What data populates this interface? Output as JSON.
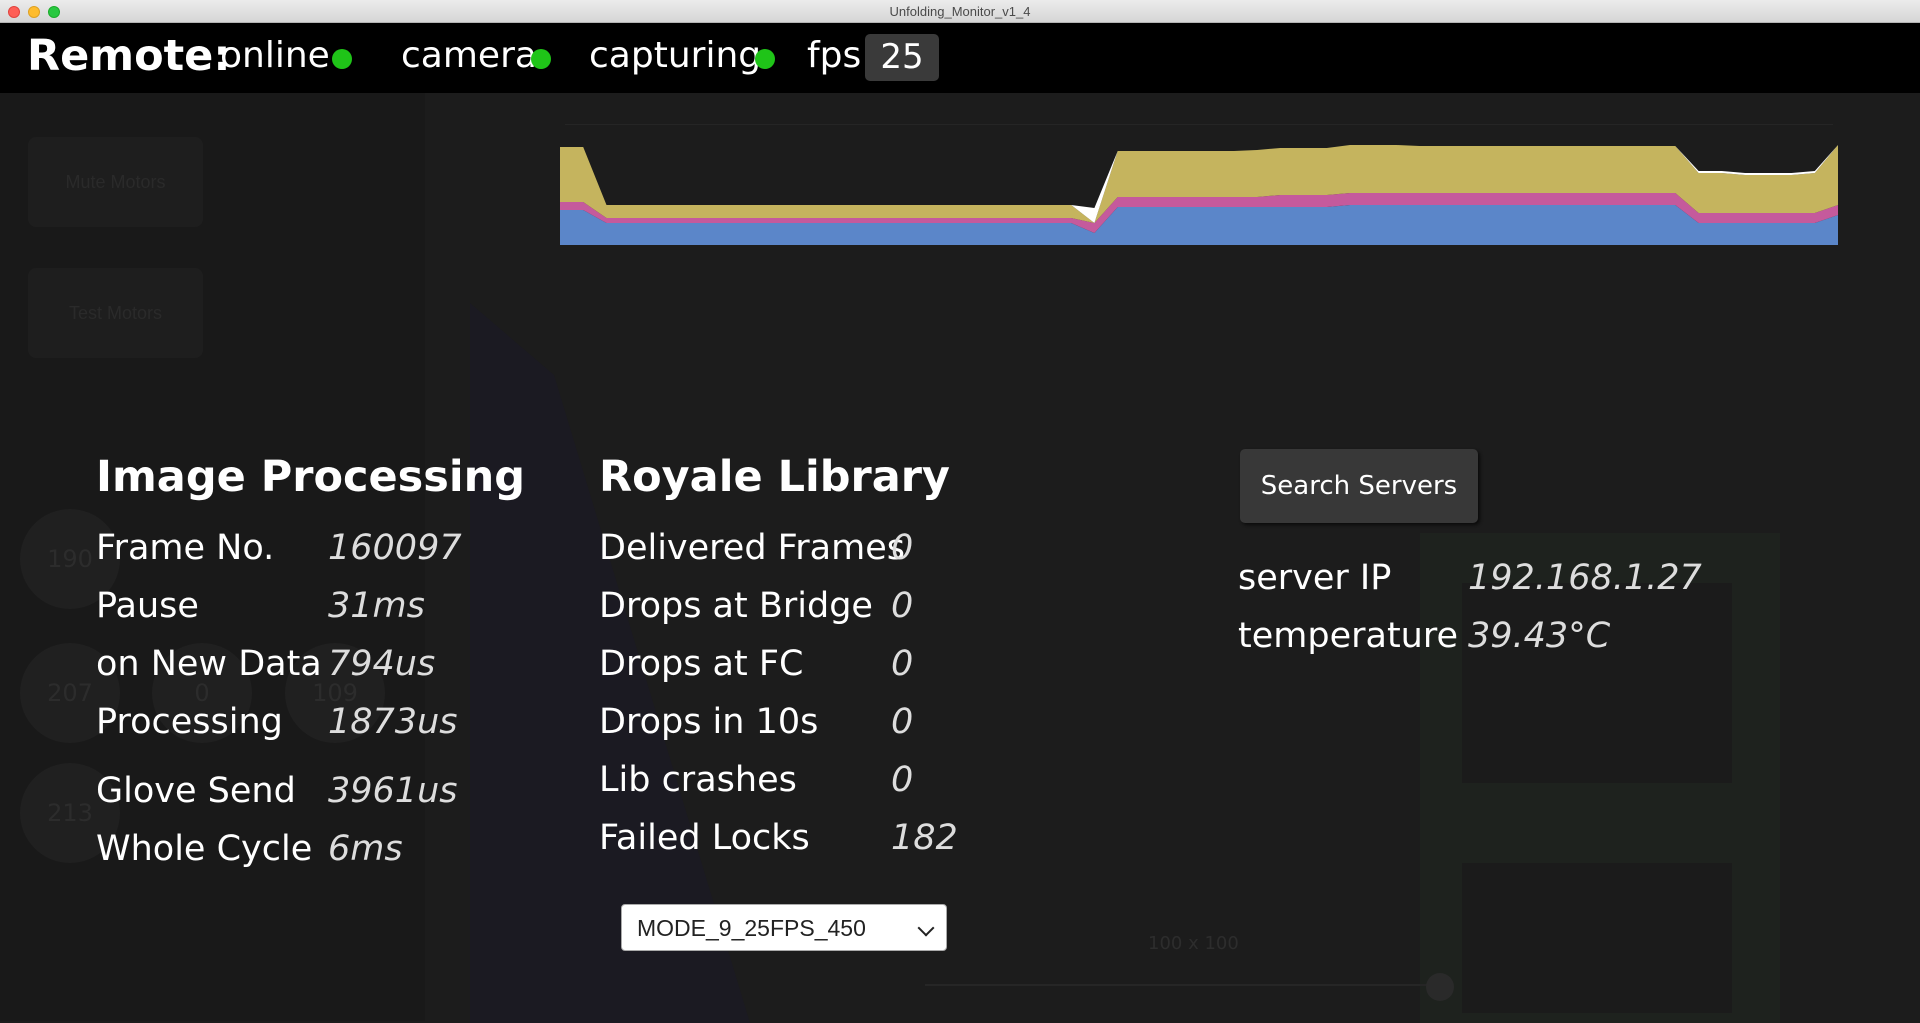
{
  "window": {
    "title": "Unfolding_Monitor_v1_4"
  },
  "remote": {
    "label": "Remote:",
    "statuses": [
      {
        "label": "online",
        "state": "green"
      },
      {
        "label": "camera",
        "state": "green"
      },
      {
        "label": "capturing",
        "state": "green"
      }
    ],
    "fps_label": "fps",
    "fps_value": "25"
  },
  "background_ghost": {
    "buttons": [
      "Mute Motors",
      "Test Motors"
    ],
    "circles": [
      "190",
      "207",
      "0",
      "109",
      "213"
    ],
    "size_label": "100 x 100"
  },
  "image_processing": {
    "title": "Image Processing",
    "rows": [
      {
        "label": "Frame No.",
        "value": "160097"
      },
      {
        "label": "Pause",
        "value": "31ms"
      },
      {
        "label": "on New Data",
        "value": "794us"
      },
      {
        "label": "Processing",
        "value": "1873us"
      },
      {
        "label": "Glove Send",
        "value": "3961us"
      },
      {
        "label": "Whole Cycle",
        "value": "6ms"
      }
    ]
  },
  "royale_library": {
    "title": "Royale Library",
    "rows": [
      {
        "label": "Delivered Frames",
        "value": "0"
      },
      {
        "label": "Drops at Bridge",
        "value": "0"
      },
      {
        "label": "Drops at FC",
        "value": "0"
      },
      {
        "label": "Drops in 10s",
        "value": "0"
      },
      {
        "label": "Lib crashes",
        "value": "0"
      },
      {
        "label": "Failed Locks",
        "value": "182"
      }
    ],
    "mode_select": "MODE_9_25FPS_450"
  },
  "server": {
    "search_button": "Search Servers",
    "rows": [
      {
        "label": "server IP",
        "value": "192.168.1.27"
      },
      {
        "label": "temperature",
        "value": "39.43°C"
      }
    ]
  },
  "chart_data": {
    "type": "area",
    "stacked": true,
    "colors": [
      "#5b86c9",
      "#c55a9c",
      "#c5b45e",
      "#ffffff"
    ],
    "series": [
      {
        "values": [
          0.35,
          0.35,
          0.22,
          0.22,
          0.22,
          0.22,
          0.22,
          0.22,
          0.22,
          0.22,
          0.22,
          0.22,
          0.22,
          0.22,
          0.22,
          0.22,
          0.22,
          0.22,
          0.22,
          0.22,
          0.22,
          0.22,
          0.22,
          0.12,
          0.38,
          0.38,
          0.38,
          0.38,
          0.38,
          0.38,
          0.38,
          0.38,
          0.38,
          0.38,
          0.4,
          0.4,
          0.4,
          0.4,
          0.4,
          0.4,
          0.4,
          0.4,
          0.4,
          0.4,
          0.4,
          0.4,
          0.4,
          0.4,
          0.4,
          0.22,
          0.22,
          0.22,
          0.22,
          0.22,
          0.22,
          0.3
        ]
      },
      {
        "values": [
          0.08,
          0.08,
          0.05,
          0.05,
          0.05,
          0.05,
          0.05,
          0.05,
          0.05,
          0.05,
          0.05,
          0.05,
          0.05,
          0.05,
          0.05,
          0.05,
          0.05,
          0.05,
          0.05,
          0.05,
          0.05,
          0.05,
          0.05,
          0.1,
          0.1,
          0.1,
          0.1,
          0.1,
          0.1,
          0.1,
          0.1,
          0.12,
          0.12,
          0.12,
          0.12,
          0.12,
          0.12,
          0.12,
          0.12,
          0.12,
          0.12,
          0.12,
          0.12,
          0.12,
          0.12,
          0.12,
          0.12,
          0.12,
          0.12,
          0.1,
          0.1,
          0.1,
          0.1,
          0.1,
          0.1,
          0.1
        ]
      },
      {
        "values": [
          0.55,
          0.55,
          0.13,
          0.13,
          0.13,
          0.13,
          0.13,
          0.13,
          0.13,
          0.13,
          0.13,
          0.13,
          0.13,
          0.13,
          0.13,
          0.13,
          0.13,
          0.13,
          0.13,
          0.13,
          0.13,
          0.13,
          0.13,
          0.0,
          0.46,
          0.46,
          0.46,
          0.46,
          0.46,
          0.46,
          0.47,
          0.47,
          0.47,
          0.47,
          0.48,
          0.48,
          0.48,
          0.47,
          0.47,
          0.47,
          0.47,
          0.47,
          0.47,
          0.47,
          0.47,
          0.47,
          0.47,
          0.47,
          0.47,
          0.4,
          0.4,
          0.38,
          0.38,
          0.38,
          0.4,
          0.6
        ]
      },
      {
        "values": [
          0.0,
          0.0,
          0.0,
          0.0,
          0.0,
          0.0,
          0.0,
          0.0,
          0.0,
          0.0,
          0.0,
          0.0,
          0.0,
          0.0,
          0.0,
          0.0,
          0.0,
          0.0,
          0.0,
          0.0,
          0.0,
          0.0,
          0.0,
          0.15,
          0.0,
          0.0,
          0.0,
          0.0,
          0.0,
          0.0,
          0.0,
          0.0,
          0.0,
          0.0,
          0.0,
          0.0,
          0.0,
          0.0,
          0.0,
          0.0,
          0.0,
          0.0,
          0.0,
          0.0,
          0.0,
          0.0,
          0.0,
          0.0,
          0.0,
          0.02,
          0.02,
          0.02,
          0.02,
          0.02,
          0.02,
          0.0
        ]
      }
    ]
  }
}
